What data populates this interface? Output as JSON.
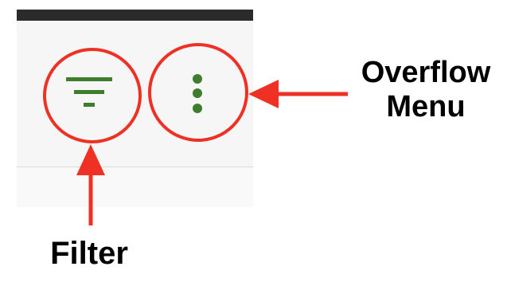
{
  "toolbar": {
    "filter_button": {
      "icon": "filter-icon",
      "icon_color": "#3e7d2c"
    },
    "overflow_button": {
      "icon": "more-vert-icon",
      "icon_color": "#3e7d2c"
    }
  },
  "annotations": {
    "color": "#ee3124",
    "overflow_label_line1": "Overflow",
    "overflow_label_line2": "Menu",
    "filter_label": "Filter"
  }
}
